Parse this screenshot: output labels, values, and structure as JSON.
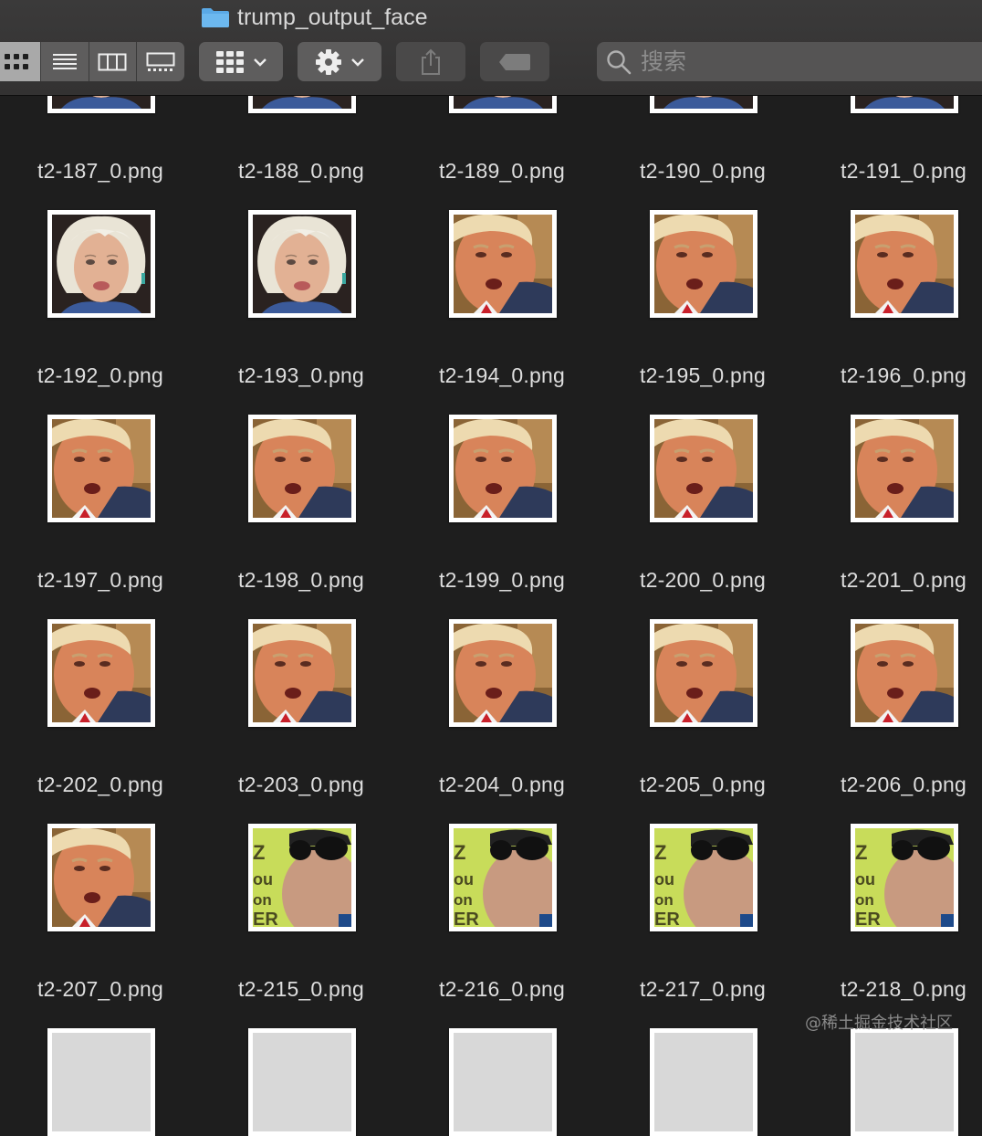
{
  "window": {
    "title": "trump_output_face",
    "folder_icon": "folder-icon"
  },
  "toolbar": {
    "view_modes": [
      {
        "name": "icon-view",
        "icon": "grid-icon",
        "active": true
      },
      {
        "name": "list-view",
        "icon": "list-icon",
        "active": false
      },
      {
        "name": "column-view",
        "icon": "columns-icon",
        "active": false
      },
      {
        "name": "gallery-view",
        "icon": "gallery-icon",
        "active": false
      }
    ],
    "group_button_icon": "group-grid-icon",
    "action_button_icon": "gear-icon",
    "share_button_icon": "share-icon",
    "tag_button_icon": "tag-icon"
  },
  "search": {
    "placeholder": "搜索",
    "value": "",
    "icon": "search-icon"
  },
  "files": [
    {
      "name": "t2-187_0.png",
      "face": "woman"
    },
    {
      "name": "t2-188_0.png",
      "face": "woman"
    },
    {
      "name": "t2-189_0.png",
      "face": "woman"
    },
    {
      "name": "t2-190_0.png",
      "face": "woman"
    },
    {
      "name": "t2-191_0.png",
      "face": "woman"
    },
    {
      "name": "t2-192_0.png",
      "face": "woman"
    },
    {
      "name": "t2-193_0.png",
      "face": "woman"
    },
    {
      "name": "t2-194_0.png",
      "face": "man"
    },
    {
      "name": "t2-195_0.png",
      "face": "man"
    },
    {
      "name": "t2-196_0.png",
      "face": "man"
    },
    {
      "name": "t2-197_0.png",
      "face": "man"
    },
    {
      "name": "t2-198_0.png",
      "face": "man"
    },
    {
      "name": "t2-199_0.png",
      "face": "man"
    },
    {
      "name": "t2-200_0.png",
      "face": "man"
    },
    {
      "name": "t2-201_0.png",
      "face": "man"
    },
    {
      "name": "t2-202_0.png",
      "face": "man"
    },
    {
      "name": "t2-203_0.png",
      "face": "man"
    },
    {
      "name": "t2-204_0.png",
      "face": "man"
    },
    {
      "name": "t2-205_0.png",
      "face": "man"
    },
    {
      "name": "t2-206_0.png",
      "face": "man"
    },
    {
      "name": "t2-207_0.png",
      "face": "man"
    },
    {
      "name": "t2-215_0.png",
      "face": "sunglasses"
    },
    {
      "name": "t2-216_0.png",
      "face": "sunglasses"
    },
    {
      "name": "t2-217_0.png",
      "face": "sunglasses"
    },
    {
      "name": "t2-218_0.png",
      "face": "sunglasses"
    },
    {
      "name": "",
      "face": "blank"
    },
    {
      "name": "",
      "face": "blank"
    },
    {
      "name": "",
      "face": "blank"
    },
    {
      "name": "",
      "face": "blank"
    },
    {
      "name": "",
      "face": "blank"
    }
  ],
  "watermark": "@稀土掘金技术社区",
  "colors": {
    "background": "#1e1e1e",
    "toolbar": "#363535",
    "folder": "#5aa9e6",
    "label": "#dedede"
  }
}
